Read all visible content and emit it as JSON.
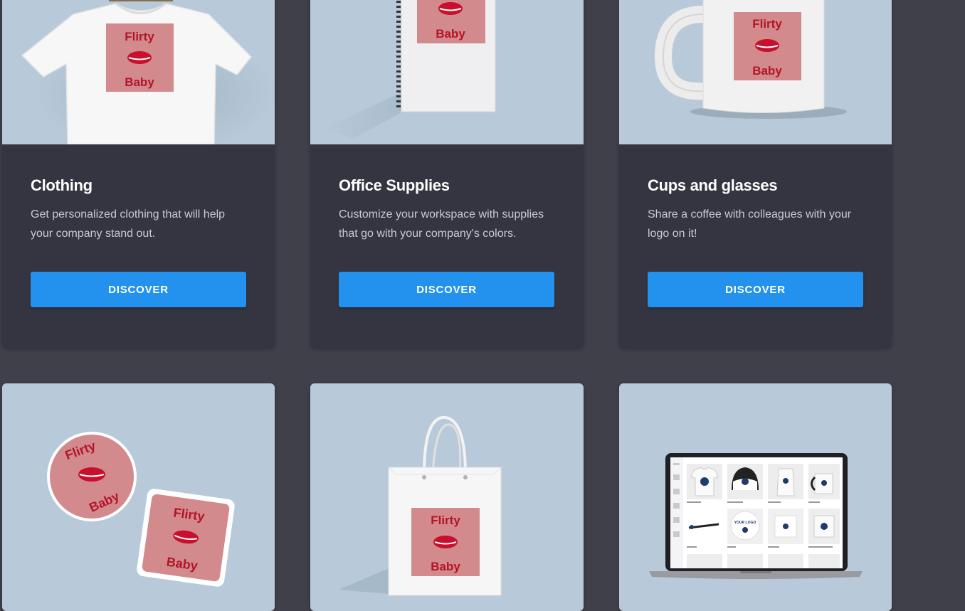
{
  "products": [
    {
      "title": "Clothing",
      "description": "Get personalized clothing that will help your company stand out.",
      "button_label": "DISCOVER",
      "image": "tshirt-mockup"
    },
    {
      "title": "Office Supplies",
      "description": "Customize your workspace with supplies that go with your company's colors.",
      "button_label": "DISCOVER",
      "image": "notebook-mockup"
    },
    {
      "title": "Cups and glasses",
      "description": "Share a coffee with colleagues with your logo on it!",
      "button_label": "DISCOVER",
      "image": "mug-mockup"
    },
    {
      "image": "stickers-mockup"
    },
    {
      "image": "shopping-bag-mockup"
    },
    {
      "image": "laptop-store-mockup"
    }
  ],
  "logo": {
    "line1": "Flirty",
    "line2": "Baby"
  },
  "laptop_screen": {
    "logo_text": "YOUR LOGO"
  },
  "colors": {
    "page_background": "#40404b",
    "card_background": "#343541",
    "image_background": "#b8cad9",
    "button": "#2391ee",
    "logo_patch": "#d38a8c",
    "logo_text": "#b3142a"
  }
}
